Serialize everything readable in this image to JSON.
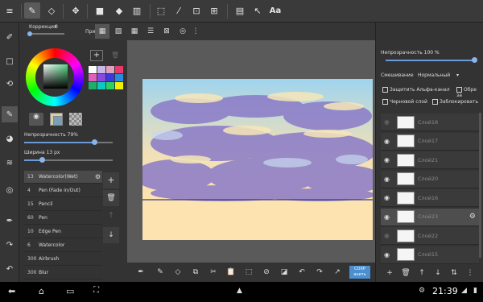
{
  "toolbar": {
    "text_tool_label": "Aa"
  },
  "subbar": {
    "correction_label": "Коррекция",
    "correction_value": "0",
    "snap_label": "Привязка"
  },
  "left_panel": {
    "opacity_label": "Непрозрачность 79%",
    "opacity_value": 0.79,
    "width_label": "Ширина 13 px",
    "width_value": 0.2,
    "brushes": [
      {
        "size": "13",
        "name": "Watercolor(Wet)",
        "selected": true
      },
      {
        "size": "4",
        "name": "Pen (Fade in/Out)",
        "selected": false
      },
      {
        "size": "15",
        "name": "Pencil",
        "selected": false
      },
      {
        "size": "60",
        "name": "Pen",
        "selected": false
      },
      {
        "size": "10",
        "name": "Edge Pen",
        "selected": false
      },
      {
        "size": "6",
        "name": "Watercolor",
        "selected": false
      },
      {
        "size": "300",
        "name": "Airbrush",
        "selected": false
      },
      {
        "size": "300",
        "name": "Blur",
        "selected": false
      }
    ],
    "palette": [
      "#ffffff",
      "#c8b8e8",
      "#e0a0c0",
      "#e83a6a",
      "#e060c0",
      "#8a4ae0",
      "#3a3ae0",
      "#2a8ae0",
      "#1ab06a",
      "#10c8c0",
      "#2ad060",
      "#f0f000"
    ]
  },
  "right_panel": {
    "opacity_label": "Непрозрачность 100 %",
    "opacity_value": 1.0,
    "blend_label": "Смешивание",
    "blend_value": "Нормальный",
    "protect_alpha": "Защитить Альфа-канал",
    "clip": "Обре за",
    "draft_layer": "Черновой слой",
    "lock": "Заблокировать",
    "layers": [
      {
        "name": "Слой18",
        "visible": false,
        "selected": false
      },
      {
        "name": "Слой17",
        "visible": true,
        "selected": false
      },
      {
        "name": "Слой21",
        "visible": true,
        "selected": false
      },
      {
        "name": "Слой20",
        "visible": true,
        "selected": false
      },
      {
        "name": "Слой16",
        "visible": true,
        "selected": false
      },
      {
        "name": "Слой23",
        "visible": true,
        "selected": true
      },
      {
        "name": "Слой22",
        "visible": false,
        "selected": false
      },
      {
        "name": "Слой15",
        "visible": true,
        "selected": false
      }
    ]
  },
  "bottombar": {
    "save_label": "СОХР анить"
  },
  "statusbar": {
    "time": "21:39"
  },
  "colors": {
    "accent": "#4a8fd0",
    "sky": "#a8d8ee",
    "ground": "#fde3b0",
    "cloud": "#8a7ac8"
  }
}
